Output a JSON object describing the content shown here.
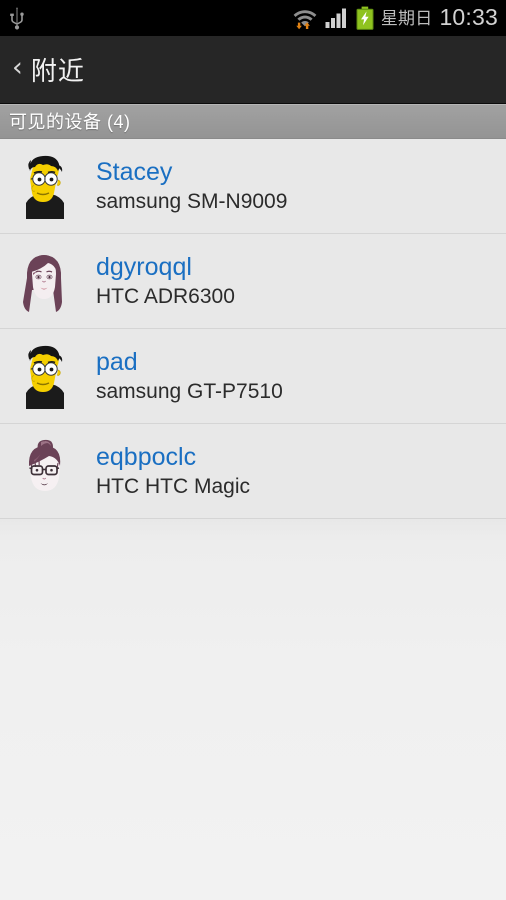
{
  "statusbar": {
    "icons": [
      "usb-icon",
      "wifi-icon",
      "signal-icon",
      "battery-icon"
    ],
    "day": "星期日",
    "time": "10:33"
  },
  "actionbar": {
    "back_label": "‹",
    "title": "附近"
  },
  "section": {
    "label": "可见的设备 (4)"
  },
  "devices": [
    {
      "name": "Stacey",
      "model": "samsung SM-N9009",
      "avatar": "avatar-simpson-male"
    },
    {
      "name": "dgyroqql",
      "model": "HTC ADR6300",
      "avatar": "avatar-woman-long-hair"
    },
    {
      "name": "pad",
      "model": "samsung GT-P7510",
      "avatar": "avatar-simpson-male"
    },
    {
      "name": "eqbpoclc",
      "model": "HTC HTC Magic",
      "avatar": "avatar-woman-bun-glasses"
    }
  ],
  "colors": {
    "accent_name": "#1a6fc2",
    "statusbar_bg": "#000000",
    "actionbar_bg": "#262626",
    "section_bg": "#9a9a9a",
    "list_bg": "#e8e8e8",
    "subtitle": "#2b2b2b"
  }
}
